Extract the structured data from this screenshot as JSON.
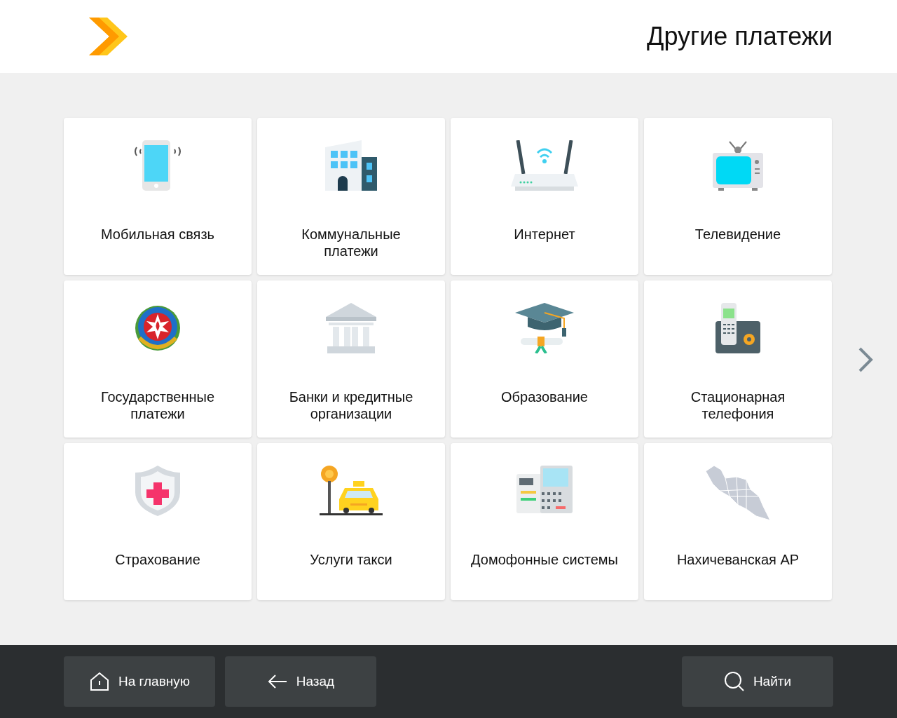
{
  "header": {
    "title": "Другие платежи"
  },
  "tiles": [
    {
      "label": "Мобильная связь"
    },
    {
      "label": "Коммунальные платежи"
    },
    {
      "label": "Интернет"
    },
    {
      "label": "Телевидение"
    },
    {
      "label": "Государственные платежи"
    },
    {
      "label": "Банки и кредитные организации"
    },
    {
      "label": "Образование"
    },
    {
      "label": "Стационарная телефония"
    },
    {
      "label": "Страхование"
    },
    {
      "label": "Услуги такси"
    },
    {
      "label": "Домофонные системы"
    },
    {
      "label": "Нахичеванская АР"
    }
  ],
  "footer": {
    "buttons": [
      {
        "label": "На главную",
        "kind": "home"
      },
      {
        "label": "Назад",
        "kind": "back"
      },
      {
        "label": "Найти",
        "kind": "search"
      }
    ]
  }
}
